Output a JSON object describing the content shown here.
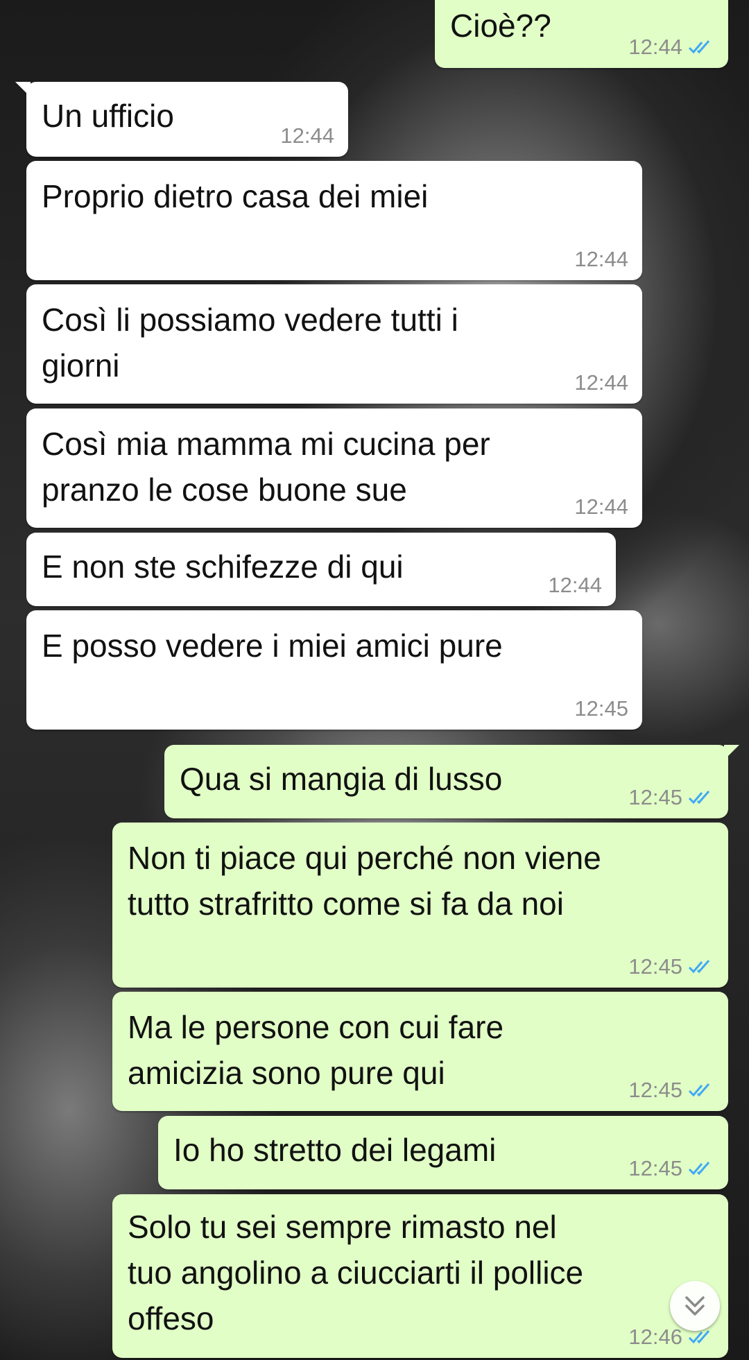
{
  "colors": {
    "incoming_bubble": "#ffffff",
    "outgoing_bubble": "#e1fec6",
    "read_ticks": "#3fa9f5",
    "timestamp": "#8c8c8c"
  },
  "messages": [
    {
      "direction": "out",
      "text": "Cioè??",
      "time": "12:44",
      "status": "read"
    },
    {
      "direction": "in",
      "text": "Un ufficio",
      "time": "12:44"
    },
    {
      "direction": "in",
      "text": "Proprio dietro casa dei miei",
      "time": "12:44"
    },
    {
      "direction": "in",
      "text": "Così li possiamo vedere tutti i\ngiorni",
      "time": "12:44"
    },
    {
      "direction": "in",
      "text": "Così mia mamma mi cucina per\npranzo le cose buone sue",
      "time": "12:44"
    },
    {
      "direction": "in",
      "text": "E non ste schifezze di qui",
      "time": "12:44"
    },
    {
      "direction": "in",
      "text": "E posso vedere i miei amici pure",
      "time": "12:45"
    },
    {
      "direction": "out",
      "text": "Qua si mangia di lusso",
      "time": "12:45",
      "status": "read"
    },
    {
      "direction": "out",
      "text": "Non ti piace qui perché non viene\ntutto strafritto come si fa da noi",
      "time": "12:45",
      "status": "read"
    },
    {
      "direction": "out",
      "text": "Ma le persone con cui fare\namicizia sono pure qui",
      "time": "12:45",
      "status": "read"
    },
    {
      "direction": "out",
      "text": "Io ho stretto dei legami",
      "time": "12:45",
      "status": "read"
    },
    {
      "direction": "out",
      "text": "Solo tu sei sempre rimasto nel\ntuo angolino a ciucciarti il pollice\noffeso",
      "time": "12:46",
      "status": "read"
    }
  ],
  "scroll_button": {
    "icon": "double-chevron-down-icon"
  }
}
